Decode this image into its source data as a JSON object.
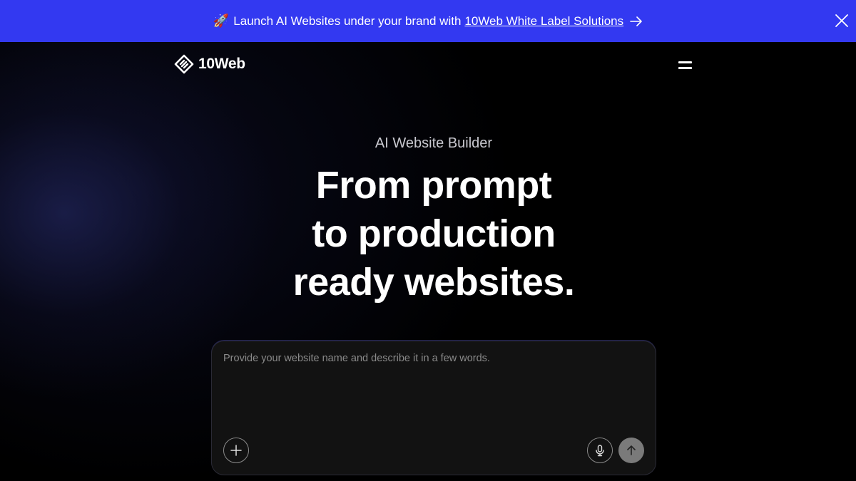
{
  "banner": {
    "rocket": "🚀",
    "text": "Launch AI Websites under your brand with",
    "link_text": "10Web White Label Solutions",
    "background": "#3339f1"
  },
  "header": {
    "logo_text": "10Web"
  },
  "hero": {
    "eyebrow": "AI Website Builder",
    "headline_line1": "From prompt",
    "headline_line2": "to production",
    "headline_line3": "ready websites."
  },
  "prompt": {
    "placeholder": "Provide your website name and describe it in a few words.",
    "value": ""
  },
  "icons": {
    "arrow": "arrow-right-icon",
    "close": "close-icon",
    "menu": "menu-icon",
    "add": "plus-icon",
    "mic": "microphone-icon",
    "send": "arrow-up-icon"
  }
}
